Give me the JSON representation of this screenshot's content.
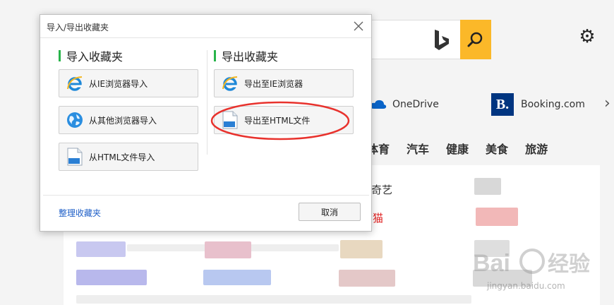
{
  "dialog": {
    "title": "导入/导出收藏夹",
    "import_section": {
      "heading": "导入收藏夹",
      "buttons": [
        {
          "label": "从IE浏览器导入",
          "icon": "ie-icon"
        },
        {
          "label": "从其他浏览器导入",
          "icon": "globe-icon"
        },
        {
          "label": "从HTML文件导入",
          "icon": "html-file-icon"
        }
      ]
    },
    "export_section": {
      "heading": "导出收藏夹",
      "buttons": [
        {
          "label": "导出至IE浏览器",
          "icon": "ie-icon"
        },
        {
          "label": "导出至HTML文件",
          "icon": "html-file-icon"
        }
      ]
    },
    "manage_link": "整理收藏夹",
    "cancel_label": "取消",
    "html_icon_text": "html"
  },
  "background": {
    "shortcuts": [
      {
        "label": "OneDrive"
      },
      {
        "label": "Booking.com",
        "logo": "B."
      }
    ],
    "categories": [
      "体育",
      "汽车",
      "健康",
      "美食",
      "旅游"
    ],
    "sites": [
      "奇艺",
      "猫"
    ]
  },
  "watermark": {
    "brand": "Bai 经验",
    "url": "jingyan.baidu.com"
  },
  "colors": {
    "accent_green": "#28b44a",
    "link_blue": "#2060c8",
    "annotation_red": "#e8322d",
    "search_yellow": "#fbb829"
  }
}
